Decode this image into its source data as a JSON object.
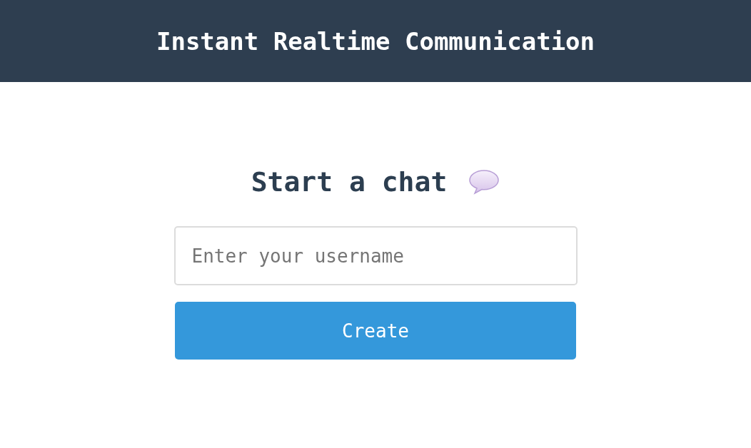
{
  "header": {
    "title": "Instant Realtime Communication"
  },
  "form": {
    "heading": "Start a chat",
    "username_field": {
      "placeholder": "Enter your username"
    },
    "button": "Create"
  }
}
